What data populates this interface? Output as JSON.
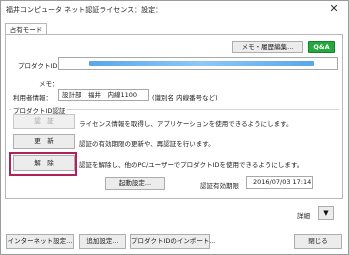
{
  "window": {
    "title": "福井コンピュータ ネット認証ライセンス：設定：",
    "close_glyph": "✕"
  },
  "tabs": [
    {
      "label": "占有モード"
    }
  ],
  "top_buttons": {
    "memo_history": "メモ・履歴編集...",
    "qa": "Q&A"
  },
  "product_id": {
    "label": "プロダクトID：",
    "value": ""
  },
  "memo": {
    "label": "メモ："
  },
  "user_info": {
    "label": "利用者情報：",
    "value": "設計部　福井　内線1100",
    "hint": "(識別名 内線番号など)"
  },
  "auth_group": {
    "label": "プロダクトID認証",
    "auth_button": "認　証",
    "auth_desc": "ライセンス情報を取得し、アプリケーションを使用できるようにします。",
    "update_button": "更　新",
    "update_desc": "認証の有効期限の更新や、再認証を行います。",
    "release_button": "解　除",
    "release_desc": "認証を解除し、他のPC/ユーザーでプロダクトIDを使用できるようにします。",
    "startup_button": "起動設定...",
    "expiry_label": "認証有効期限",
    "expiry_value": "2016/07/03 17:14"
  },
  "detail": {
    "label": "詳細",
    "arrow": "▼"
  },
  "footer": {
    "internet_settings": "インターネット設定...",
    "add_settings": "追加設定...",
    "import_pid": "プロダクトIDのインポート...",
    "close": "閉じる"
  }
}
